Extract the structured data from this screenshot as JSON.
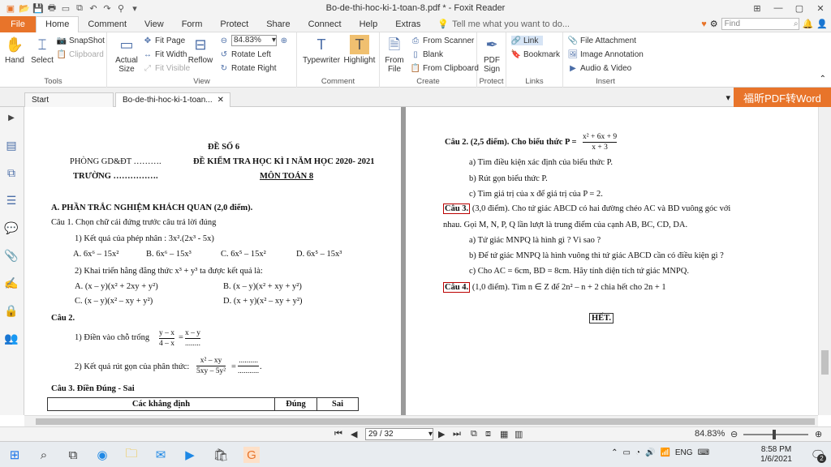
{
  "window": {
    "title": "Bo-de-thi-hoc-ki-1-toan-8.pdf * - Foxit Reader"
  },
  "menu": {
    "file": "File",
    "tabs": [
      "Home",
      "Comment",
      "View",
      "Form",
      "Protect",
      "Share",
      "Connect",
      "Help",
      "Extras"
    ],
    "tell_me": "Tell me what you want to do...",
    "find_placeholder": "Find"
  },
  "ribbon": {
    "tools": {
      "hand": "Hand",
      "select": "Select",
      "snapshot": "SnapShot",
      "clipboard": "Clipboard",
      "label": "Tools"
    },
    "view": {
      "actual_size": "Actual Size",
      "fit_page": "Fit Page",
      "fit_width": "Fit Width",
      "fit_visible": "Fit Visible",
      "reflow": "Reflow",
      "zoom": "84.83%",
      "rotate_left": "Rotate Left",
      "rotate_right": "Rotate Right",
      "label": "View"
    },
    "comment": {
      "typewriter": "Typewriter",
      "highlight": "Highlight",
      "label": "Comment"
    },
    "create": {
      "from_file": "From File",
      "from_scanner": "From Scanner",
      "blank": "Blank",
      "from_clipboard": "From Clipboard",
      "label": "Create"
    },
    "protect": {
      "pdf_sign": "PDF Sign",
      "label": "Protect"
    },
    "links": {
      "link": "Link",
      "bookmark": "Bookmark",
      "label": "Links"
    },
    "insert": {
      "file_attachment": "File Attachment",
      "image_annotation": "Image Annotation",
      "audio_video": "Audio & Video",
      "label": "Insert"
    }
  },
  "tabs": {
    "start": "Start",
    "doc": "Bo-de-thi-hoc-ki-1-toan...",
    "promo": "福昕PDF转Word"
  },
  "left_page": {
    "de_so": "ĐỀ SỐ 6",
    "phong": "PHÒNG GD&ĐT ……….",
    "truong": "TRƯỜNG …………….",
    "heading": "ĐỀ KIỂM TRA HỌC KÌ I NĂM HỌC 2020- 2021",
    "mon": "MÔN TOÁN 8",
    "section_a": "A. PHẦN TRẮC NGHIỆM KHÁCH QUAN (2,0 điểm).",
    "cau1": "Câu 1. Chọn chữ cái đứng trước câu trả lời đúng",
    "q1": "1) Kết quả của phép nhân : 3x².(2x³ - 5x)",
    "q1_opts": [
      "A. 6x⁶ – 15x²",
      "B. 6x⁶ – 15x³",
      "C. 6x⁵ – 15x²",
      "D. 6x⁵ – 15x³"
    ],
    "q2": "2)  Khai triển hằng đẳng thức x³ + y³ ta được kết quả là:",
    "q2_opts": [
      "A. (x – y)(x² + 2xy + y²)",
      "B. (x – y)(x² + xy + y²)",
      "C. (x – y)(x² – xy + y²)",
      "D. (x + y)(x² – xy + y²)"
    ],
    "cau2": "Câu 2.",
    "c2_q1": "1) Điền vào chỗ trống",
    "c2_q1_frac": [
      "y – x",
      "4 – x",
      "x – y",
      "........"
    ],
    "c2_q2": "2) Kết quả rút gọn của phân thức:",
    "c2_q2_frac": [
      "x² – xy",
      "5xy – 5y²",
      "..........",
      "..........."
    ],
    "cau3": "Câu 3. Điền Đúng - Sai",
    "table_headers": [
      "Các khẳng định",
      "Đúng",
      "Sai"
    ]
  },
  "right_page": {
    "cau2": "Câu 2. (2,5 điểm). Cho biểu thức P =",
    "p_frac": [
      "x² + 6x + 9",
      "x + 3"
    ],
    "c2a": "a) Tìm điều kiện xác định của biểu thức P.",
    "c2b": "b) Rút gọn biểu thức P.",
    "c2c": "c) Tìm giá trị của x để giá trị của P = 2.",
    "cau3_label": "Câu 3.",
    "cau3_text": "(3,0 điểm). Cho tứ giác ABCD có hai đường chéo AC và BD vuông góc với",
    "cau3_text2": "nhau. Gọi M, N, P, Q lần lượt là trung điểm của cạnh AB, BC, CD, DA.",
    "c3a": "a) Tứ giác MNPQ là hình gì ? Vì sao ?",
    "c3b": "b) Để tứ giác MNPQ là hình vuông thì tứ giác ABCD cần có điều kiện gì ?",
    "c3c": "c) Cho AC = 6cm, BD = 8cm. Hãy tính diện tích tứ giác MNPQ.",
    "cau4_label": "Câu 4.",
    "cau4_text": "(1,0 điểm). Tìm  n ∈ Z  để  2n² – n + 2   chia hết cho  2n + 1",
    "het": "HẾT."
  },
  "status": {
    "page": "29 / 32",
    "zoom": "84.83%"
  },
  "taskbar": {
    "lang": "ENG",
    "time": "8:58 PM",
    "date": "1/6/2021",
    "notif": "2"
  }
}
